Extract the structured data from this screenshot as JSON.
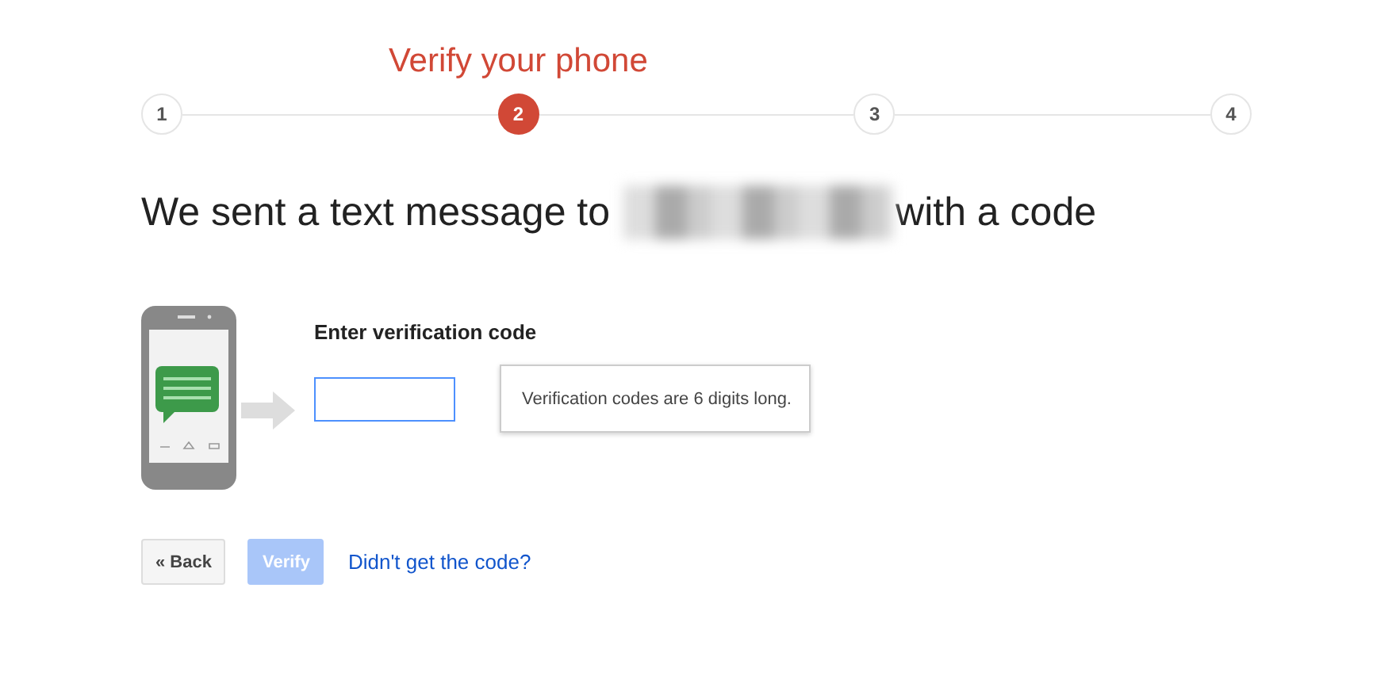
{
  "steps": [
    {
      "number": "1",
      "selected": false
    },
    {
      "number": "2",
      "selected": true,
      "title": "Verify your phone"
    },
    {
      "number": "3",
      "selected": false
    },
    {
      "number": "4",
      "selected": false
    }
  ],
  "heading": {
    "before": "We sent a text message to",
    "after": "with a code"
  },
  "code_field": {
    "label": "Enter verification code"
  },
  "tooltip": "Verification codes are 6 digits long.",
  "buttons": [
    {
      "label": "« Back",
      "kind": "back",
      "disabled": false
    },
    {
      "label": "Verify",
      "kind": "primary",
      "disabled": true
    }
  ],
  "link": "Didn't get the code?"
}
